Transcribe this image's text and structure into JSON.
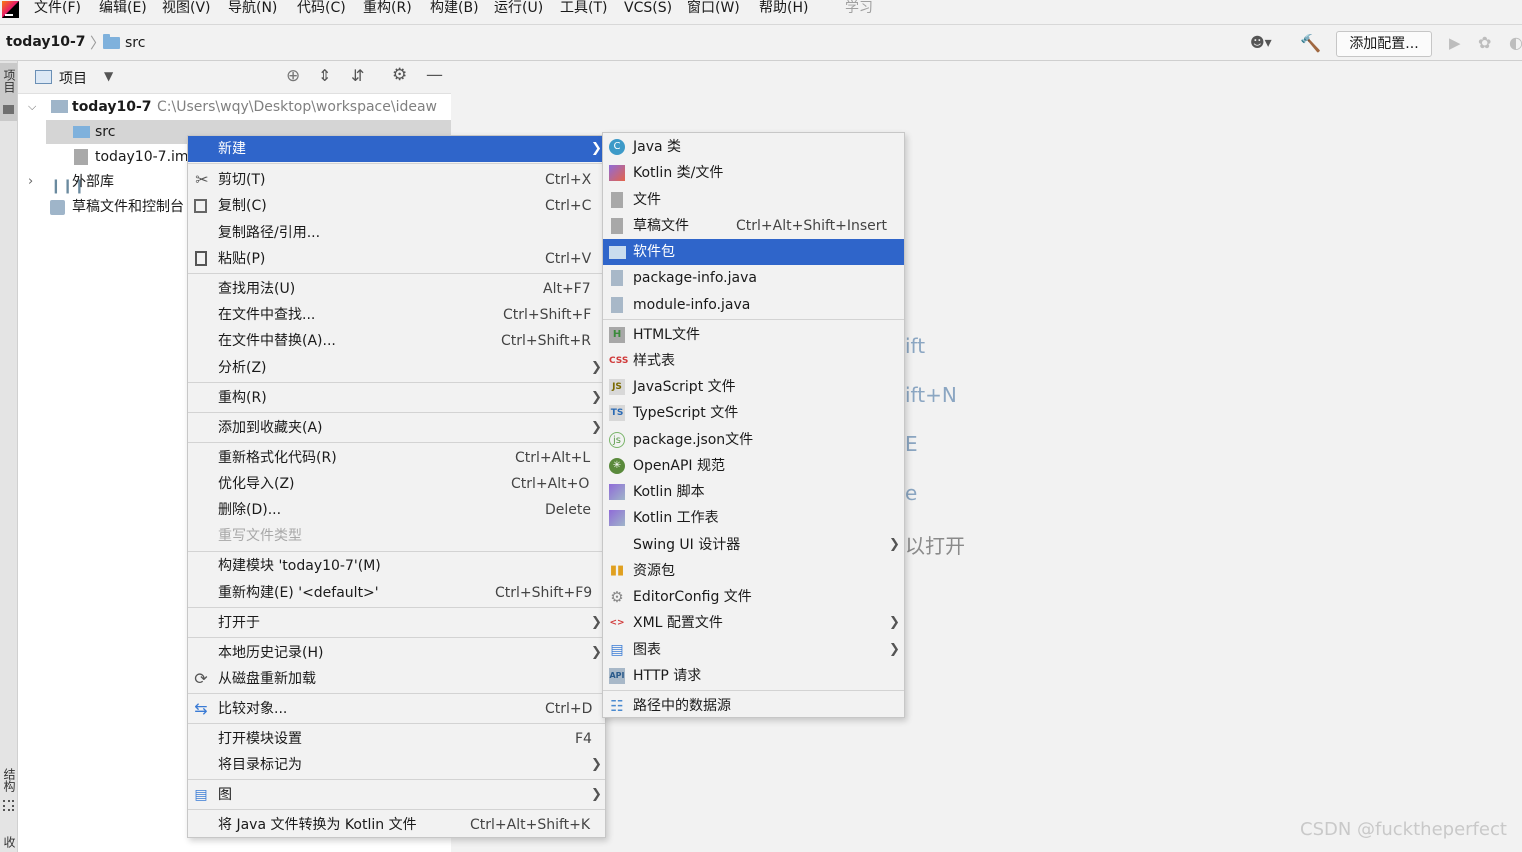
{
  "menubar": {
    "items": [
      "文件(F)",
      "编辑(E)",
      "视图(V)",
      "导航(N)",
      "代码(C)",
      "重构(R)",
      "构建(B)",
      "运行(U)",
      "工具(T)",
      "VCS(S)",
      "窗口(W)",
      "帮助(H)",
      "学习"
    ]
  },
  "navbar": {
    "project": "today10-7",
    "folder": "src",
    "add_config_label": "添加配置..."
  },
  "stripe": {
    "project_label": "项目",
    "structure_label": "结构",
    "bottom_label": "收"
  },
  "panel": {
    "title": "项目"
  },
  "tree": {
    "root_name": "today10-7",
    "root_path": "C:\\Users\\wqy\\Desktop\\workspace\\ideaw",
    "src": "src",
    "iml": "today10-7.im",
    "external_libs": "外部库",
    "scratches": "草稿文件和控制台"
  },
  "editor_hints": [
    "ift",
    "ift+N",
    "E",
    "e",
    "以打开"
  ],
  "context_menu": [
    {
      "label": "新建",
      "shortcut": "",
      "submenu": true,
      "highlighted": true,
      "icon": ""
    },
    {
      "label": "剪切(T)",
      "shortcut": "Ctrl+X",
      "icon": "scissors-icon"
    },
    {
      "label": "复制(C)",
      "shortcut": "Ctrl+C",
      "icon": "copy-icon"
    },
    {
      "label": "复制路径/引用...",
      "shortcut": ""
    },
    {
      "label": "粘贴(P)",
      "shortcut": "Ctrl+V",
      "icon": "paste-icon"
    },
    {
      "label": "查找用法(U)",
      "shortcut": "Alt+F7"
    },
    {
      "label": "在文件中查找...",
      "shortcut": "Ctrl+Shift+F"
    },
    {
      "label": "在文件中替换(A)...",
      "shortcut": "Ctrl+Shift+R"
    },
    {
      "label": "分析(Z)",
      "shortcut": "",
      "submenu": true
    },
    {
      "label": "重构(R)",
      "shortcut": "",
      "submenu": true
    },
    {
      "label": "添加到收藏夹(A)",
      "shortcut": "",
      "submenu": true
    },
    {
      "label": "重新格式化代码(R)",
      "shortcut": "Ctrl+Alt+L"
    },
    {
      "label": "优化导入(Z)",
      "shortcut": "Ctrl+Alt+O"
    },
    {
      "label": "删除(D)...",
      "shortcut": "Delete"
    },
    {
      "label": "重写文件类型",
      "shortcut": "",
      "disabled": true
    },
    {
      "label": "构建模块 'today10-7'(M)",
      "shortcut": ""
    },
    {
      "label": "重新构建(E) '<default>'",
      "shortcut": "Ctrl+Shift+F9"
    },
    {
      "label": "打开于",
      "shortcut": "",
      "submenu": true
    },
    {
      "label": "本地历史记录(H)",
      "shortcut": "",
      "submenu": true
    },
    {
      "label": "从磁盘重新加载",
      "shortcut": "",
      "icon": "reload-icon"
    },
    {
      "label": "比较对象...",
      "shortcut": "Ctrl+D",
      "icon": "compare-icon"
    },
    {
      "label": "打开模块设置",
      "shortcut": "F4"
    },
    {
      "label": "将目录标记为",
      "shortcut": "",
      "submenu": true
    },
    {
      "label": "图",
      "shortcut": "",
      "submenu": true,
      "icon": "diagram-icon"
    },
    {
      "label": "将 Java 文件转换为 Kotlin 文件",
      "shortcut": "Ctrl+Alt+Shift+K"
    }
  ],
  "submenu": [
    {
      "label": "Java 类",
      "shortcut": "",
      "icon": "java-class-icon"
    },
    {
      "label": "Kotlin 类/文件",
      "shortcut": "",
      "icon": "kotlin-icon"
    },
    {
      "label": "文件",
      "shortcut": "",
      "icon": "file-icon"
    },
    {
      "label": "草稿文件",
      "shortcut": "Ctrl+Alt+Shift+Insert",
      "icon": "scratch-file-icon"
    },
    {
      "label": "软件包",
      "shortcut": "",
      "highlighted": true,
      "icon": "package-icon"
    },
    {
      "label": "package-info.java",
      "shortcut": "",
      "icon": "java-file-icon"
    },
    {
      "label": "module-info.java",
      "shortcut": "",
      "icon": "java-file-icon"
    },
    {
      "label": "HTML文件",
      "shortcut": "",
      "icon": "html-icon"
    },
    {
      "label": "样式表",
      "shortcut": "",
      "icon": "css-icon"
    },
    {
      "label": "JavaScript 文件",
      "shortcut": "",
      "icon": "js-icon"
    },
    {
      "label": "TypeScript 文件",
      "shortcut": "",
      "icon": "ts-icon"
    },
    {
      "label": "package.json文件",
      "shortcut": "",
      "icon": "nodejs-icon"
    },
    {
      "label": "OpenAPI 规范",
      "shortcut": "",
      "icon": "openapi-icon"
    },
    {
      "label": "Kotlin 脚本",
      "shortcut": "",
      "icon": "kotlin-script-icon"
    },
    {
      "label": "Kotlin 工作表",
      "shortcut": "",
      "icon": "kotlin-worksheet-icon"
    },
    {
      "label": "Swing UI 设计器",
      "shortcut": "",
      "submenu": true
    },
    {
      "label": "资源包",
      "shortcut": "",
      "icon": "resource-bundle-icon"
    },
    {
      "label": "EditorConfig 文件",
      "shortcut": "",
      "icon": "gear-icon"
    },
    {
      "label": "XML 配置文件",
      "shortcut": "",
      "submenu": true,
      "icon": "xml-icon"
    },
    {
      "label": "图表",
      "shortcut": "",
      "submenu": true,
      "icon": "diagram-icon"
    },
    {
      "label": "HTTP 请求",
      "shortcut": "",
      "icon": "api-icon"
    },
    {
      "label": "路径中的数据源",
      "shortcut": "",
      "icon": "database-icon"
    }
  ],
  "watermark": "CSDN @fucktheperfect",
  "colors": {
    "highlight": "#2f65ca",
    "background": "#f2f2f2",
    "folder": "#7fb1dc"
  }
}
